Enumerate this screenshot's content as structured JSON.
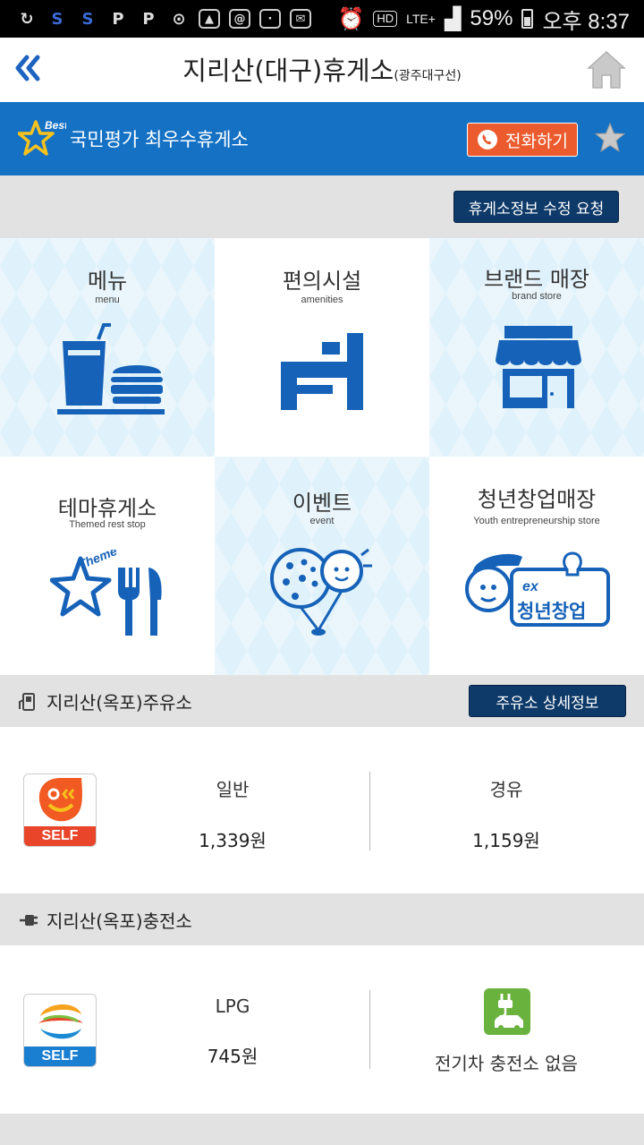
{
  "status_bar": {
    "battery": "59%",
    "time": "오후 8:37",
    "network": "LTE+",
    "hd": "HD",
    "icons": [
      "refresh-icon",
      "samsung-s-icon",
      "samsung-s-icon",
      "p-app-icon",
      "p-app-icon",
      "vpn-icon",
      "image-icon",
      "email-icon",
      "galaxy-icon",
      "mail-icon",
      "alarm-icon",
      "signal-icon",
      "battery-icon"
    ]
  },
  "header": {
    "title": "지리산(대구)휴게소",
    "title_suffix": "(광주대구선)",
    "back_icon": "double-chevron-left-icon",
    "home_icon": "home-icon",
    "accent": "#1e63c0"
  },
  "banner": {
    "badge": "Best",
    "text": "국민평가 최우수휴게소",
    "call_label": "전화하기",
    "bg": "#1471c4",
    "call_bg": "#ec5b2d"
  },
  "request_button": "휴게소정보 수정 요청",
  "tiles": [
    {
      "title": "메뉴",
      "sub": "menu",
      "icon": "food-drink-icon"
    },
    {
      "title": "편의시설",
      "sub": "amenities",
      "icon": "bench-icon"
    },
    {
      "title": "브랜드 매장",
      "sub": "brand store",
      "icon": "storefront-icon"
    },
    {
      "title": "테마휴게소",
      "sub": "Themed rest stop",
      "icon": "theme-star-cutlery-icon",
      "badge": "Theme"
    },
    {
      "title": "이벤트",
      "sub": "event",
      "icon": "balloons-icon"
    },
    {
      "title": "청년창업매장",
      "sub": "Youth entrepreneurship store",
      "icon": "youth-startup-icon",
      "badge_ex": "ex",
      "badge_text": "청년창업"
    }
  ],
  "gas": {
    "section_title": "지리산(옥포)주유소",
    "detail_button": "주유소 상세정보",
    "logo_label": "SELF",
    "items": [
      {
        "label": "일반",
        "price": "1,339원"
      },
      {
        "label": "경유",
        "price": "1,159원"
      }
    ]
  },
  "charge": {
    "section_title": "지리산(옥포)충전소",
    "logo_label": "SELF",
    "lpg_label": "LPG",
    "lpg_price": "745원",
    "ev_text": "전기차 충전소 없음"
  }
}
